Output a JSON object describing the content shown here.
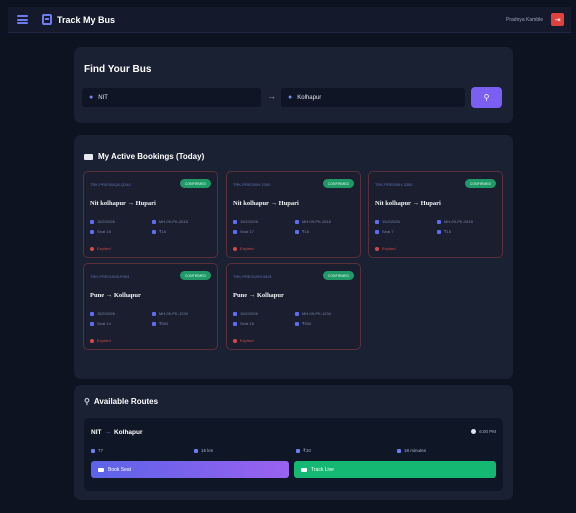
{
  "header": {
    "app_title": "Track My Bus",
    "user_name": "Pradnya Kamble",
    "logout_icon": "logout-icon"
  },
  "search": {
    "title": "Find Your Bus",
    "from_value": "NIT",
    "to_value": "Kolhapur",
    "swap_glyph": "→",
    "button_glyph": "⚲"
  },
  "bookings": {
    "title": "My Active Bookings (Today)",
    "cards": [
      {
        "id": "TRK-PRE000Q8-Q240",
        "badge": "CONFIRMED",
        "route": "Nit kolhapur → Hupari",
        "date": "15/2/2026",
        "bus": "MH-09-PK-2618",
        "seat": "Seat 16",
        "fare": "₹16",
        "status": "Expired"
      },
      {
        "id": "TRK-PRE000H-7000",
        "badge": "CONFIRMED",
        "route": "Nit kolhapur → Hupari",
        "date": "15/2/2026",
        "bus": "MH-09-PK-2618",
        "seat": "Seat 17",
        "fare": "₹16",
        "status": "Expired"
      },
      {
        "id": "TRK-PRE000H-3300",
        "badge": "CONFIRMED",
        "route": "Nit kolhapur → Hupari",
        "date": "15/2/2026",
        "bus": "MH-09-PK-2618",
        "seat": "Seat 7",
        "fare": "₹15",
        "status": "Expired"
      },
      {
        "id": "TRK-PRE01595-P304",
        "badge": "CONFIRMED",
        "route": "Pune → Kolhapur",
        "date": "15/2/2026",
        "bus": "MH-09-PK-1234",
        "seat": "Seat 14",
        "fare": "₹500",
        "status": "Expired"
      },
      {
        "id": "TRK-PRE01269-9401",
        "badge": "CONFIRMED",
        "route": "Pune → Kolhapur",
        "date": "15/2/2026",
        "bus": "MH-09-PK-1234",
        "seat": "Seat 18",
        "fare": "₹500",
        "status": "Expired"
      }
    ]
  },
  "routes": {
    "title": "Available Routes",
    "items": [
      {
        "from": "NIT",
        "to": "Kolhapur",
        "arrow": "→",
        "time": "6:00 PM",
        "bus_no": "77",
        "distance": "15 km",
        "fare": "₹10",
        "duration": "18 minutes",
        "book_label": "Book Seat",
        "track_label": "Track Live"
      }
    ]
  },
  "colors": {
    "background": "#0e1322",
    "panel": "#1a2133",
    "accent": "#7b5ff2",
    "confirmed": "#1f9a66",
    "expired": "#d24a4a",
    "track": "#14b872"
  }
}
